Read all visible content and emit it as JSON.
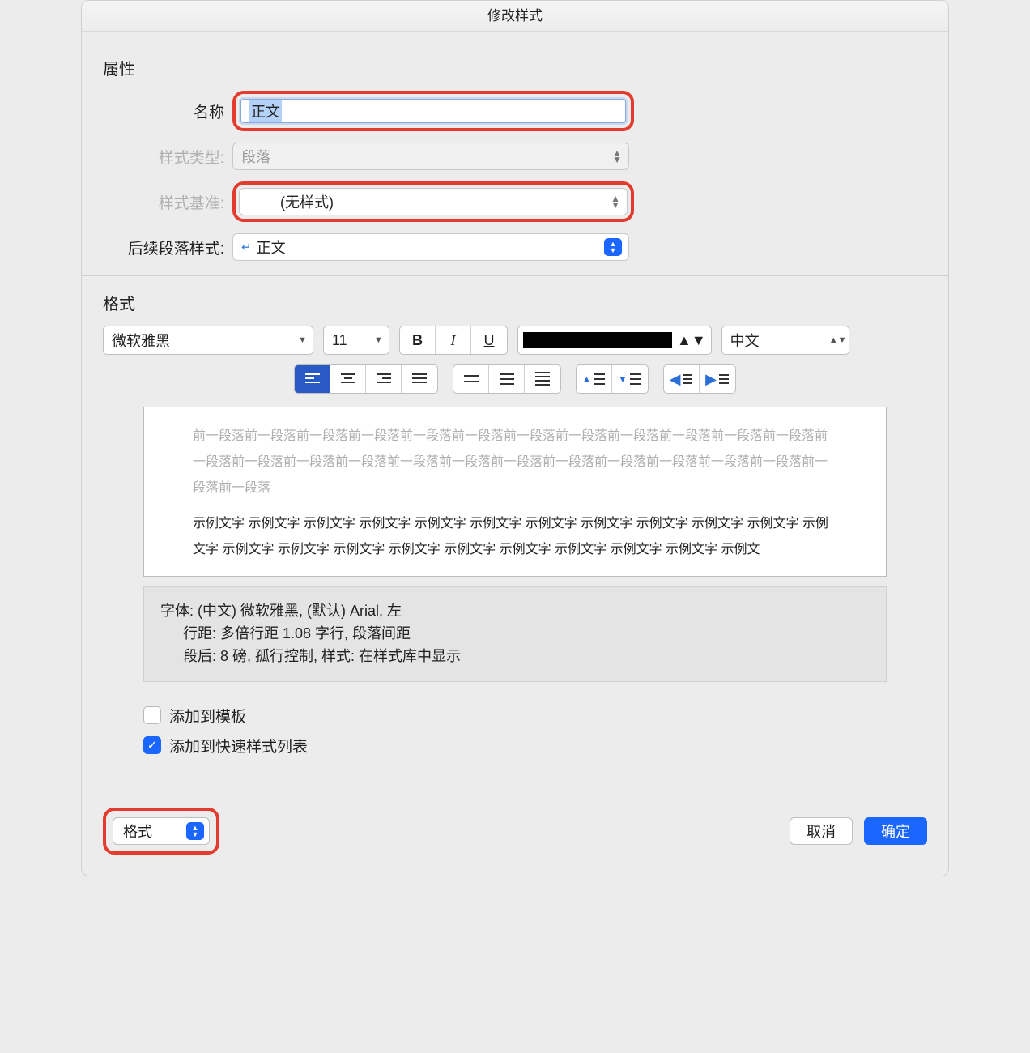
{
  "title": "修改样式",
  "props": {
    "section": "属性",
    "name_label": "名称",
    "name_value": "正文",
    "type_label": "样式类型:",
    "type_value": "段落",
    "based_label": "样式基准:",
    "based_value": "(无样式)",
    "next_label": "后续段落样式:",
    "next_value": "正文"
  },
  "format": {
    "section": "格式",
    "font": "微软雅黑",
    "size": "11",
    "lang": "中文",
    "blue_chev": "▲▼"
  },
  "preview": {
    "ghost": "前一段落前一段落前一段落前一段落前一段落前一段落前一段落前一段落前一段落前一段落前一段落前一段落前一段落前一段落前一段落前一段落前一段落前一段落前一段落前一段落前一段落前一段落前一段落前一段落前一段落前一段落",
    "sample": "示例文字 示例文字 示例文字 示例文字 示例文字 示例文字 示例文字 示例文字 示例文字 示例文字 示例文字 示例文字 示例文字 示例文字 示例文字 示例文字 示例文字 示例文字 示例文字 示例文字 示例文字 示例文"
  },
  "desc": {
    "line1": "字体: (中文) 微软雅黑, (默认) Arial, 左",
    "line2": "行距: 多倍行距 1.08 字行, 段落间距",
    "line3": "段后: 8 磅, 孤行控制, 样式: 在样式库中显示"
  },
  "checks": {
    "add_template": "添加到模板",
    "add_quick": "添加到快速样式列表"
  },
  "footer": {
    "format": "格式",
    "cancel": "取消",
    "ok": "确定"
  }
}
